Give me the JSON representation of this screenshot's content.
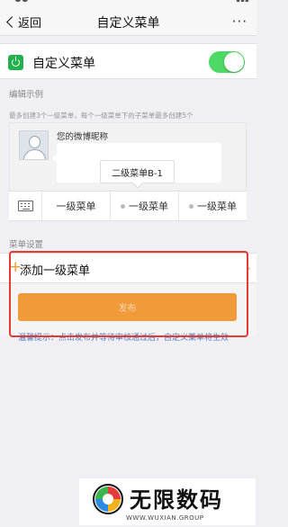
{
  "nav": {
    "back_label": "返回",
    "title": "自定义菜单",
    "more_label": "···"
  },
  "toggle": {
    "label": "自定义菜单",
    "enabled": true,
    "accent_color": "#4cd964"
  },
  "edit_example": {
    "section_label": "编辑示例",
    "hint": "最多创建3个一级菜单，每个一级菜单下的子菜单最多创建5个",
    "nickname": "您的微博昵称",
    "submenu_label": "二级菜单B-1",
    "menu_items": [
      {
        "label": "一级菜单"
      },
      {
        "label": "一级菜单"
      },
      {
        "label": "一级菜单"
      }
    ]
  },
  "settings": {
    "section_label": "菜单设置",
    "add_label": "添加一级菜单",
    "publish_label": "发布",
    "warm_tip": "温馨提示：点击发布并等待审核通过后，自定义菜单将生效",
    "publish_color": "#f09a3a",
    "highlight_color": "#e53935"
  },
  "watermark": {
    "title": "无限数码",
    "subtitle": "WWW.WUXIAN.GROUP"
  }
}
